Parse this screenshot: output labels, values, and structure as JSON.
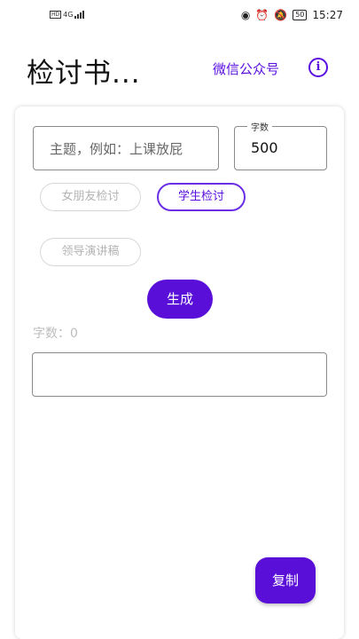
{
  "status_bar": {
    "left_badge": "HD",
    "net": "4G",
    "time": "15:27",
    "battery": "50"
  },
  "appbar": {
    "title": "检讨书...",
    "link": "微信公众号",
    "info_icon": "info-circle-icon",
    "accent": "#5a10e0"
  },
  "form": {
    "topic_placeholder": "主题，例如：上课放屁",
    "count_label": "字数",
    "count_value": "500"
  },
  "chips": [
    {
      "label": "女朋友检讨",
      "selected": false
    },
    {
      "label": "学生检讨",
      "selected": true
    },
    {
      "label": "领导演讲稿",
      "selected": false
    }
  ],
  "generate_label": "生成",
  "word_count": "字数：0",
  "output_text": "",
  "copy_label": "复制"
}
